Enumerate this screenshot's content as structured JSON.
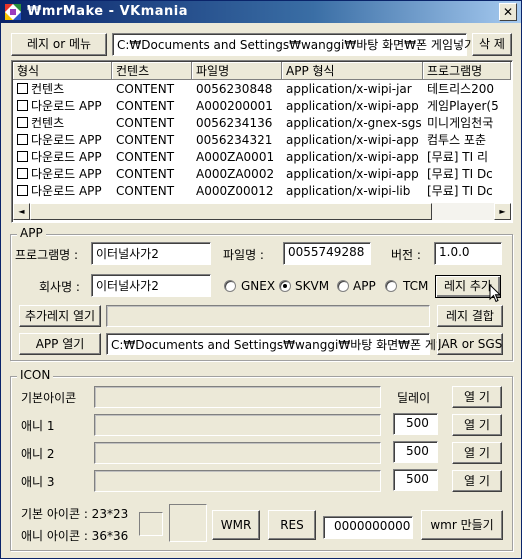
{
  "window": {
    "title": "₩mrMake  -  VKmania",
    "close_glyph": "✕"
  },
  "toolbar": {
    "registry_menu_label": "레지 or 메뉴",
    "path_value": "C:₩Documents and Settings₩wanggi₩바탕 화면₩폰 게임넣기₩",
    "delete_label": "삭 제"
  },
  "list": {
    "columns": [
      "형식",
      "컨텐츠",
      "파일명",
      "APP 형식",
      "프로그램명"
    ],
    "rows": [
      {
        "type": "컨텐츠",
        "content": "CONTENT",
        "file": "0056230848",
        "app_type": "application/x-wipi-jar",
        "program": "테트리스200"
      },
      {
        "type": "다운로드 APP",
        "content": "CONTENT",
        "file": "A000200001",
        "app_type": "application/x-wipi-app",
        "program": "게임Player(5"
      },
      {
        "type": "컨텐츠",
        "content": "CONTENT",
        "file": "0056234136",
        "app_type": "application/x-gnex-sgs",
        "program": "미니게임천국"
      },
      {
        "type": "다운로드 APP",
        "content": "CONTENT",
        "file": "0056234321",
        "app_type": "application/x-wipi-app",
        "program": "컴투스 포춘"
      },
      {
        "type": "다운로드 APP",
        "content": "CONTENT",
        "file": "A000ZA0001",
        "app_type": "application/x-wipi-app",
        "program": "[무료] TI 리"
      },
      {
        "type": "다운로드 APP",
        "content": "CONTENT",
        "file": "A000ZA0002",
        "app_type": "application/x-wipi-app",
        "program": "[무료] TI Dc"
      },
      {
        "type": "다운로드 APP",
        "content": "CONTENT",
        "file": "A000Z00012",
        "app_type": "application/x-wipi-lib",
        "program": "[무료] TI Dc"
      }
    ],
    "scroll_left": "◄",
    "scroll_right": "►"
  },
  "app": {
    "group_title": "APP",
    "program_name_label": "프로그램명 :",
    "program_name_value": "이터널사가2",
    "file_name_label": "파일명 :",
    "file_name_value": "0055749288",
    "version_label": "버전 :",
    "version_value": "1.0.0",
    "company_label": "회사명 :",
    "company_value": "이터널사가2",
    "radio_gnex": "GNEX",
    "radio_skvm": "SKVM",
    "radio_app": "APP",
    "radio_tcm": "TCM",
    "registry_add_label": "레지 추가",
    "open_extra_registry_label": "추가레지 열기",
    "extra_registry_value": "",
    "registry_merge_label": "레지 결합",
    "open_app_label": "APP 열기",
    "app_path_value": "C:₩Documents and Settings₩wanggi₩바탕 화면₩폰 게임",
    "jar_sgs_label": "JAR or SGS"
  },
  "icon": {
    "group_title": "ICON",
    "basic_icon_label": "기본아이콘",
    "delay_label": "딜레이",
    "anim1_label": "애니 1",
    "anim2_label": "애니 2",
    "anim3_label": "애니 3",
    "delay1": "500",
    "delay2": "500",
    "delay3": "500",
    "open_label": "열 기",
    "basic_icon_size": "기본 아이콘 : 23*23",
    "anim_icon_size": "애니 아이콘 : 36*36",
    "wmr_label": "WMR",
    "res_label": "RES",
    "code_value": "0000000000",
    "make_wmr_label": "wmr 만들기"
  }
}
